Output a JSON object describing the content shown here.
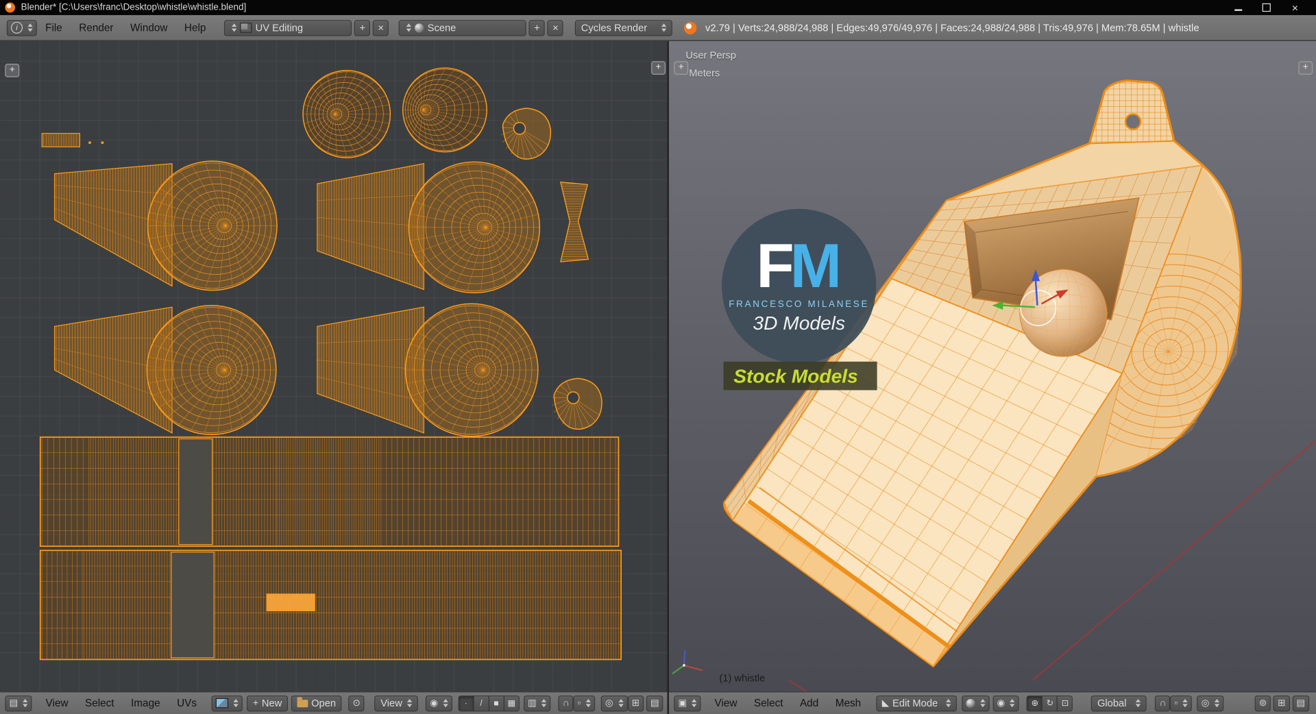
{
  "window": {
    "title": "Blender* [C:\\Users\\franc\\Desktop\\whistle\\whistle.blend]",
    "close_glyph": "×"
  },
  "top_header": {
    "menus": [
      "File",
      "Render",
      "Window",
      "Help"
    ],
    "layout": "UV Editing",
    "scene": "Scene",
    "engine": "Cycles Render",
    "stats": "v2.79 | Verts:24,988/24,988 | Edges:49,976/49,976 | Faces:24,988/24,988 | Tris:49,976 | Mem:78.65M | whistle"
  },
  "uv_editor": {
    "menus": [
      "View",
      "Select",
      "Image",
      "UVs"
    ],
    "buttons": {
      "new": "New",
      "open": "Open"
    },
    "mode": "View"
  },
  "viewport": {
    "view_label": "User Persp",
    "units_label": "Meters",
    "object_info": "(1) whistle",
    "menus": [
      "View",
      "Select",
      "Add",
      "Mesh"
    ],
    "mode": "Edit Mode",
    "orientation": "Global",
    "watermark": {
      "f": "F",
      "m": "M",
      "subtitle": "FRANCESCO MILANESE",
      "line2": "3D Models",
      "badge": "Stock Models"
    }
  },
  "icons": {
    "plus": "+",
    "close": "×",
    "info": "i",
    "editor_image": "▤",
    "editor_3d": "▣",
    "pin": "⊙",
    "pivot": "◉",
    "sticky": "▥",
    "uv_vertex": "∙",
    "uv_edge": "/",
    "uv_face": "■",
    "uv_island": "▦",
    "snap": "∩",
    "snap_target": "▫",
    "proportional": "◎",
    "edit_mode": "◣",
    "shading": "●",
    "manip_translate": "⊕",
    "manip_rotate": "↻",
    "manip_scale": "⊡",
    "overlay_1": "⊚",
    "overlay_2": "▤",
    "overlay_3": "⊞"
  },
  "colors": {
    "selection_orange": "#ff9d1c",
    "wire_orange": "#ef8c12",
    "uv_background": "#3b3e40",
    "header_gray": "#707070",
    "viewport_top": "#75757d",
    "viewport_bottom": "#4b4b53",
    "logo_blue": "#47b1e8",
    "badge_green": "#cadd33"
  }
}
